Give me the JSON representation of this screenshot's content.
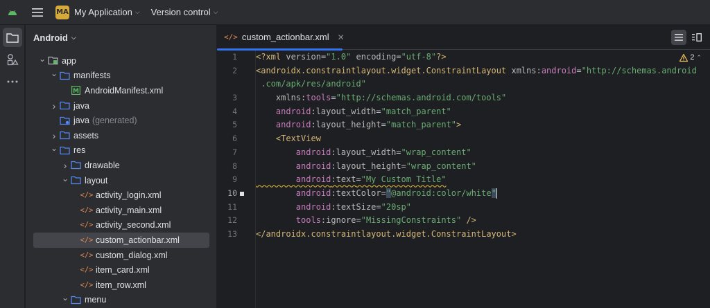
{
  "titlebar": {
    "project_badge": "MA",
    "project_name": "My Application",
    "vcs_label": "Version control"
  },
  "project_panel": {
    "view_mode": "Android",
    "tree": [
      {
        "label": "app",
        "depth": 0,
        "expanded": true,
        "icon": "module-folder-icon"
      },
      {
        "label": "manifests",
        "depth": 1,
        "expanded": true,
        "icon": "folder-icon"
      },
      {
        "label": "AndroidManifest.xml",
        "depth": 2,
        "icon": "manifest-file-icon"
      },
      {
        "label": "java",
        "depth": 1,
        "expanded": false,
        "icon": "folder-icon"
      },
      {
        "label": "java",
        "suffix": "(generated)",
        "depth": 1,
        "icon": "generated-folder-icon"
      },
      {
        "label": "assets",
        "depth": 1,
        "expanded": false,
        "icon": "folder-icon"
      },
      {
        "label": "res",
        "depth": 1,
        "expanded": true,
        "icon": "folder-icon"
      },
      {
        "label": "drawable",
        "depth": 2,
        "expanded": false,
        "icon": "folder-icon"
      },
      {
        "label": "layout",
        "depth": 2,
        "expanded": true,
        "icon": "folder-icon"
      },
      {
        "label": "activity_login.xml",
        "depth": 3,
        "icon": "xml-file-icon"
      },
      {
        "label": "activity_main.xml",
        "depth": 3,
        "icon": "xml-file-icon"
      },
      {
        "label": "activity_second.xml",
        "depth": 3,
        "icon": "xml-file-icon"
      },
      {
        "label": "custom_actionbar.xml",
        "depth": 3,
        "icon": "xml-file-icon",
        "selected": true
      },
      {
        "label": "custom_dialog.xml",
        "depth": 3,
        "icon": "xml-file-icon"
      },
      {
        "label": "item_card.xml",
        "depth": 3,
        "icon": "xml-file-icon"
      },
      {
        "label": "item_row.xml",
        "depth": 3,
        "icon": "xml-file-icon"
      },
      {
        "label": "menu",
        "depth": 2,
        "expanded": true,
        "icon": "folder-icon"
      }
    ]
  },
  "editor": {
    "tab_label": "custom_actionbar.xml",
    "warnings_count": "2",
    "line_numbers": [
      "1",
      "2",
      "",
      "3",
      "4",
      "5",
      "6",
      "7",
      "8",
      "9",
      "10",
      "11",
      "12",
      "13"
    ],
    "current_line": "10"
  },
  "colors": {
    "accent": "#3574f0",
    "folder_blue": "#548af7",
    "xml_orange": "#e08855",
    "android_green": "#5fb865"
  }
}
